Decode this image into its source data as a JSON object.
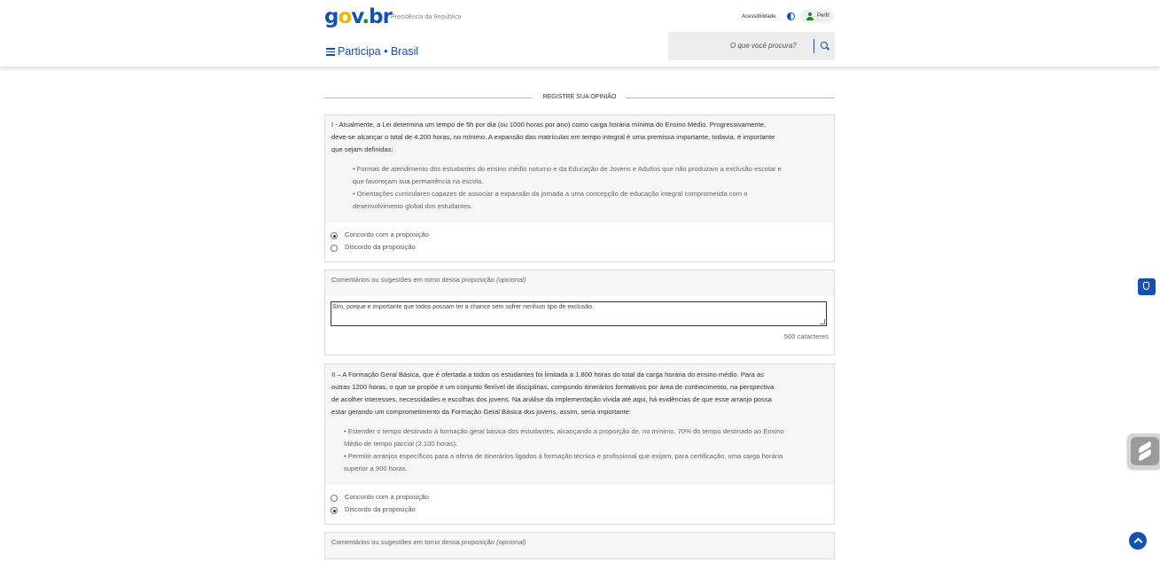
{
  "header": {
    "logo": {
      "g": "g",
      "o": "o",
      "v": "v",
      "dot": ".",
      "b": "b",
      "r": "r"
    },
    "org": "Presidência da República",
    "accessibility": "Acessibilidade",
    "profile": "Perfil",
    "site_title": "Participa • Brasil",
    "search_placeholder": "O que você procura?"
  },
  "section_title": "REGISTRE SUA OPINIÃO",
  "questions": [
    {
      "text_lines": [
        "I - Atualmente, a Lei determina um tempo de 5h por dia (ou 1000 horas por ano) como carga horária mínima do Ensino Médio. Progressivamente,",
        "deve-se alcançar o total de 4.200 horas, no mínimo. A expansão das matrículas em tempo integral é uma premissa importante, todavia, é importante",
        "que sejam definidas:"
      ],
      "bullets": [
        "• Formas de atendimento dos estudantes do ensino médio noturno e da Educação de Jovens e Adultos que não produzam a exclusão escolar e",
        "que favoreçam sua permanência na escola.",
        "• Orientações curriculares capazes de associar a expansão da jornada a uma concepção de educação integral comprometida com o",
        "desenvolvimento global dos estudantes."
      ],
      "options": [
        {
          "label": "Concordo com a proposição",
          "checked": true
        },
        {
          "label": "Discordo da proposição",
          "checked": false
        }
      ],
      "comment_label": "Comentários ou sugestões em torno dessa proposição",
      "comment_optional": "(opcional)",
      "comment_value": "Sim, porque e importante que todos possam ter a chance sem sofrer nenhum tipo de exclusão.",
      "chars_left": "500 caracteres"
    },
    {
      "text_lines": [
        "II – A Formação Geral Básica, que é ofertada a todos os estudantes foi limitada a 1.800 horas do total da carga horária do ensino médio. Para as",
        "outras 1200 horas, o que se propõe é um conjunto flexível de disciplinas, compondo itinerários formativos por área de conhecimento, na perspectiva",
        "de acolher interesses, necessidades e escolhas dos jovens. Na análise da implementação vivida até aqui, há evidências de que esse arranjo possa",
        "estar gerando um comprometimento da Formação Geral Básica dos jovens, assim, seria importante:"
      ],
      "bullets": [
        "• Estender o tempo destinado à formação geral básica dos estudantes, alcançando a proporção de, no mínimo, 70% do tempo destinado ao Ensino",
        "Médio de tempo parcial (2.100 horas).",
        "• Permitir arranjos específicos para a oferta de itinerários ligados à formação técnica e profissional que exijam, para certificação, uma carga horária",
        "superior a 900 horas."
      ],
      "options": [
        {
          "label": "Concordo com a proposição",
          "checked": false
        },
        {
          "label": "Discordo da proposição",
          "checked": true
        }
      ],
      "comment_label": "Comentários ou sugestões em torno dessa proposição",
      "comment_optional": "(opcional)"
    }
  ]
}
